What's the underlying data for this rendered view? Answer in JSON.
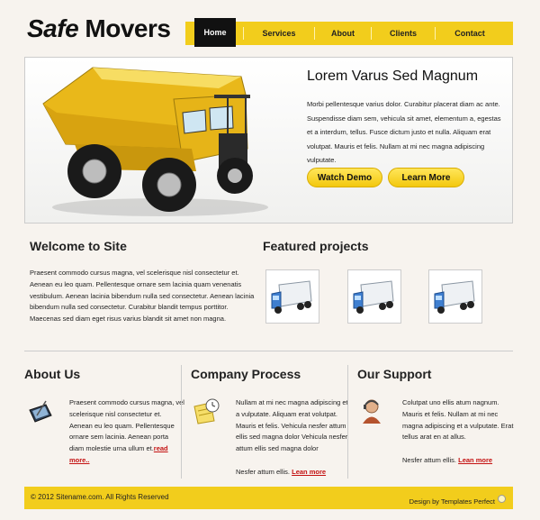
{
  "logo": {
    "part1": "Safe",
    "part2": " Movers"
  },
  "nav": {
    "items": [
      "Home",
      "Services",
      "About",
      "Clients",
      "Contact"
    ]
  },
  "hero": {
    "title": "Lorem Varus Sed Magnum",
    "text": "Morbi pellentesque varius dolor. Curabitur placerat diam ac ante. Suspendisse diam sem, vehicula sit amet, elementum a, egestas et a interdum, tellus. Fusce dictum justo et nulla. Aliquam erat volutpat. Mauris et felis. Nullam at mi nec magna adipiscing vulputate.",
    "demo_label": "Watch Demo",
    "more_label": "Learn More"
  },
  "welcome": {
    "title": "Welcome to Site",
    "text": "Praesent commodo cursus magna, vel scelerisque nisl consectetur et. Aenean eu leo quam. Pellentesque ornare sem lacinia quam venenatis vestibulum. Aenean lacinia bibendum nulla sed consectetur. Aenean lacinia bibendum nulla sed consectetur. Curabitur blandit tempus porttitor. Maecenas sed diam eget risus varius blandit sit amet non magna."
  },
  "featured": {
    "title": "Featured projects"
  },
  "about": {
    "title": "About Us",
    "text": "Praesent commodo cursus magna, vel scelerisque nisl consectetur et. Aenean eu leo quam. Pellentesque ornare sem lacinia. Aenean porta diam molestie urna ullum et.",
    "link": "read more.."
  },
  "process": {
    "title": "Company Process",
    "text": "Nullam at mi nec magna adipiscing et a vulputate. Aliquam erat volutpat. Mauris et felis. Vehicula nesfer attum ellis sed magna dolor Vehicula nesfer attum ellis sed magna dolor",
    "text2": "Nesfer attum ellis. ",
    "link": "Lean more"
  },
  "support": {
    "title": "Our Support",
    "text": "Colutpat uno ellis atum nagnum. Mauris et felis. Nullam at mi nec magna adipiscing et a vulputate. Erat tellus arat en at allus.",
    "text2": "Nesfer attum ellis. ",
    "link": "Lean more"
  },
  "footer": {
    "copyright": "© 2012 Sitename.com. All Rights Reserved",
    "credit": "Design by Templates Perfect"
  },
  "colors": {
    "accent": "#f2cd1c",
    "link": "#c41212",
    "nav_active": "#111111"
  }
}
